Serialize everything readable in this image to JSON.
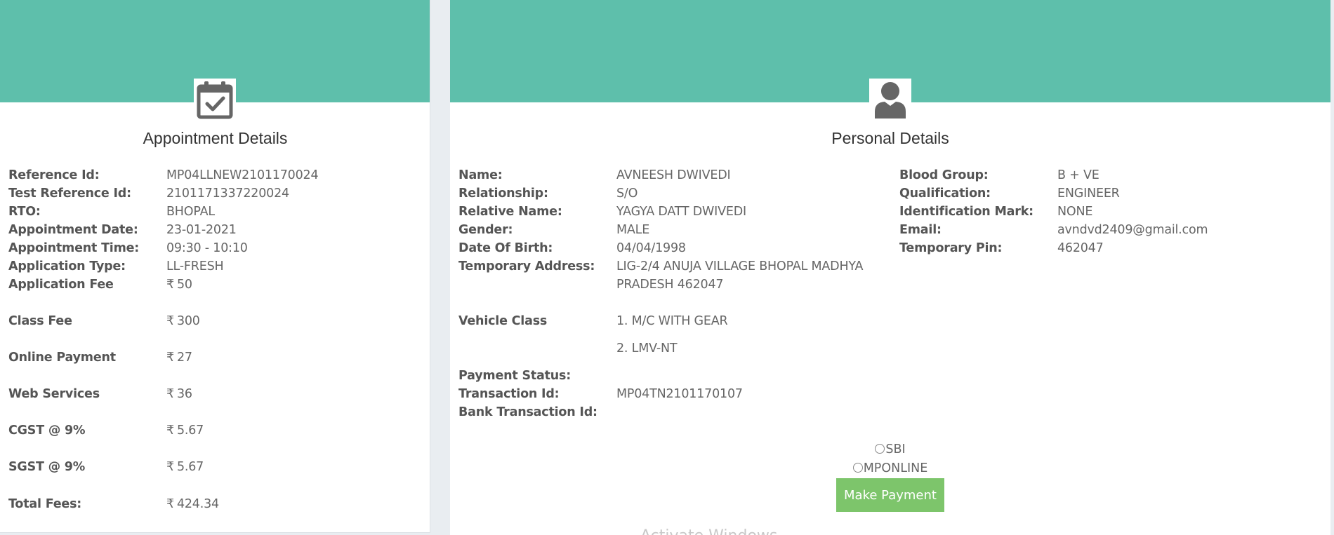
{
  "appointment": {
    "title": "Appointment Details",
    "icon": "calendar-check-icon",
    "rows": [
      {
        "label": "Reference Id:",
        "value": "MP04LLNEW2101170024"
      },
      {
        "label": "Test Reference Id:",
        "value": "2101171337220024"
      },
      {
        "label": "RTO:",
        "value": "BHOPAL"
      },
      {
        "label": "Appointment Date:",
        "value": "23-01-2021"
      },
      {
        "label": "Appointment Time:",
        "value": "09:30 - 10:10"
      },
      {
        "label": "Application Type:",
        "value": "LL-FRESH"
      }
    ],
    "currency_symbol": "₹",
    "fees": [
      {
        "label": "Application Fee",
        "value": "50"
      },
      {
        "label": "Class Fee",
        "value": "300"
      },
      {
        "label": "Online Payment",
        "value": "27"
      },
      {
        "label": "Web Services",
        "value": "36"
      },
      {
        "label": "CGST @ 9%",
        "value": "5.67"
      },
      {
        "label": "SGST @ 9%",
        "value": "5.67"
      },
      {
        "label": "Total Fees:",
        "value": "424.34"
      }
    ]
  },
  "personal": {
    "title": "Personal Details",
    "icon": "user-icon",
    "left_rows": [
      {
        "label": "Name:",
        "value": "AVNEESH DWIVEDI"
      },
      {
        "label": "Relationship:",
        "value": "S/O"
      },
      {
        "label": "Relative Name:",
        "value": "YAGYA DATT DWIVEDI"
      },
      {
        "label": "Gender:",
        "value": "MALE"
      },
      {
        "label": "Date Of Birth:",
        "value": "04/04/1998"
      },
      {
        "label": "Temporary Address:",
        "value": "LIG-2/4 ANUJA VILLAGE BHOPAL MADHYA",
        "value2": "PRADESH 462047"
      }
    ],
    "right_rows": [
      {
        "label": "Blood Group:",
        "value": "B + VE"
      },
      {
        "label": "Qualification:",
        "value": "ENGINEER"
      },
      {
        "label": "Identification Mark:",
        "value": "NONE"
      },
      {
        "label": "Email:",
        "value": "avndvd2409@gmail.com"
      },
      {
        "label": "Temporary Pin:",
        "value": "462047"
      }
    ],
    "vehicle_class_label": "Vehicle Class",
    "vehicle_classes": [
      "1. M/C WITH GEAR",
      "2. LMV-NT"
    ],
    "payment_rows": [
      {
        "label": "Payment Status:",
        "value": ""
      },
      {
        "label": "Transaction Id:",
        "value": "MP04TN2101170107"
      },
      {
        "label": "Bank Transaction Id:",
        "value": ""
      }
    ],
    "payment_options": [
      "SBI",
      "MPONLINE"
    ],
    "pay_button": "Make Payment"
  },
  "colors": {
    "banner": "#5ebfab",
    "button": "#7dc56b"
  },
  "watermark": "Activate Windows"
}
